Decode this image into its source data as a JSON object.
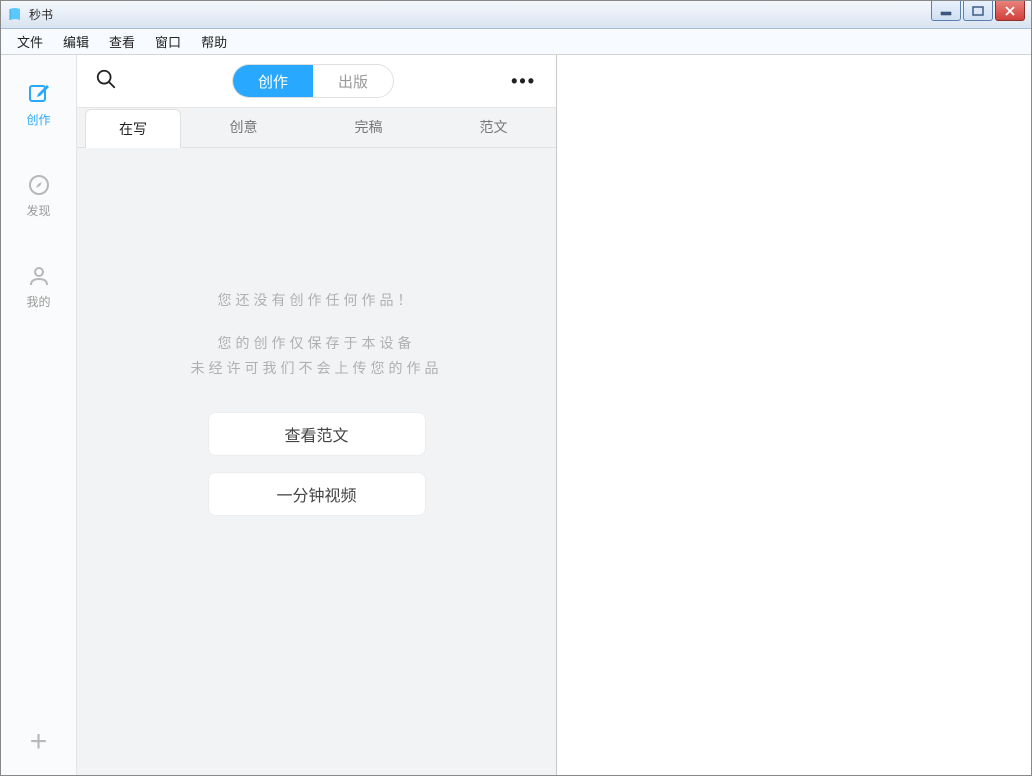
{
  "titlebar": {
    "title": "秒书"
  },
  "menubar": {
    "file": "文件",
    "edit": "编辑",
    "view": "查看",
    "window": "窗口",
    "help": "帮助"
  },
  "sidebar": {
    "items": [
      {
        "label": "创作",
        "icon": "compose-icon",
        "active": true
      },
      {
        "label": "发现",
        "icon": "discover-icon",
        "active": false
      },
      {
        "label": "我的",
        "icon": "profile-icon",
        "active": false
      }
    ]
  },
  "midcol": {
    "segmented": {
      "create": "创作",
      "publish": "出版",
      "active": "创作"
    },
    "tabs": {
      "writing": "在写",
      "idea": "创意",
      "done": "完稿",
      "sample": "范文",
      "active": "在写"
    },
    "empty": {
      "line1": "您还没有创作任何作品！",
      "line2": "您的创作仅保存于本设备",
      "line3": "未经许可我们不会上传您的作品"
    },
    "buttons": {
      "view_samples": "查看范文",
      "one_minute_video": "一分钟视频"
    }
  }
}
